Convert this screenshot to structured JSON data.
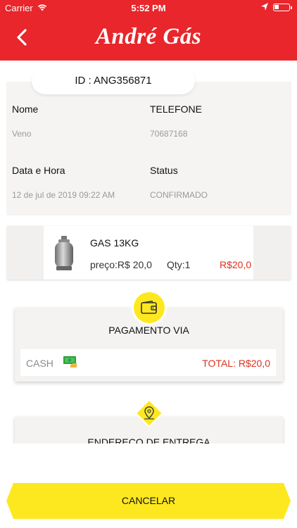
{
  "status_bar": {
    "carrier": "Carrier",
    "time": "5:52 PM"
  },
  "header": {
    "title": "André Gás",
    "back_icon": "chevron-left-icon",
    "color": "#e8262b"
  },
  "order": {
    "id_label": "ID : ANG356871",
    "name_label": "Nome",
    "name_value": "Veno",
    "phone_label": "TELEFONE",
    "phone_value": "70687168",
    "datetime_label": "Data e Hora",
    "datetime_value": "12 de jul de 2019 09:22 AM",
    "status_label": "Status",
    "status_value": "CONFIRMADO"
  },
  "product": {
    "name": "GAS 13KG",
    "price": "preço:R$ 20,0",
    "qty": "Qty:1",
    "total": "R$20,0",
    "icon": "gas-cylinder-icon"
  },
  "payment": {
    "title": "PAGAMENTO VIA",
    "method": "CASH",
    "total": "TOTAL: R$20,0",
    "badge_icon": "wallet-icon",
    "method_icon": "cash-icon"
  },
  "address": {
    "title": "ENDEREÇO DE ENTREGA",
    "badge_icon": "map-pin-icon"
  },
  "actions": {
    "cancel": "CANCELAR"
  },
  "colors": {
    "accent_red": "#e8262b",
    "accent_yellow": "#fde81f",
    "price_red": "#e0301e"
  }
}
